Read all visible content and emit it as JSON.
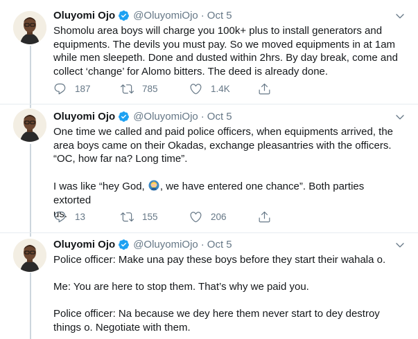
{
  "tweets": [
    {
      "name": "Oluyomi Ojo",
      "handle": "@OluyomiOjo",
      "separator": "·",
      "date": "Oct 5",
      "lines": [
        "Shomolu area boys will charge you 100k+ plus to install generators and",
        "equipments. The devils you must pay. So we moved equipments in at 1am",
        "while men sleepeth. Done and dusted within 2hrs. By day break, come and",
        "collect ‘change’ for Alomo bitters. The deed is already done."
      ],
      "replies": "187",
      "retweets": "785",
      "likes": "1.4K"
    },
    {
      "name": "Oluyomi Ojo",
      "handle": "@OluyomiOjo",
      "separator": "·",
      "date": "Oct 5",
      "lines": [
        "One time we called and paid police officers, when equipments arrived, the",
        "area boys came on their Okadas, exchange pleasantries with the officers.",
        "“OC, how far na? Long time”."
      ],
      "line_before_emoji": "I was like “hey God, ",
      "line_after_emoji": ", we have entered one chance”. Both parties extorted",
      "line_last": "us.",
      "emoji_icon": "man-facepalming-emoji",
      "replies": "13",
      "retweets": "155",
      "likes": "206"
    },
    {
      "name": "Oluyomi Ojo",
      "handle": "@OluyomiOjo",
      "separator": "·",
      "date": "Oct 5",
      "para1": "Police officer: Make una pay these boys before they start their wahala o.",
      "para2": "Me: You are here to stop them. That’s why we paid you.",
      "para3_line1": "Police officer: Na because we dey here them never start to dey destroy",
      "para3_line2": "things o. Negotiate with them."
    }
  ],
  "colors": {
    "text": "#14171a",
    "muted": "#657786",
    "verified": "#1da1f2",
    "thread_line": "#ccd6dd",
    "divider": "#e6ecf0"
  },
  "icons": {
    "reply": "reply-icon",
    "retweet": "retweet-icon",
    "like": "heart-icon",
    "share": "share-icon",
    "more": "chevron-down-icon",
    "verified": "verified-badge-icon"
  }
}
